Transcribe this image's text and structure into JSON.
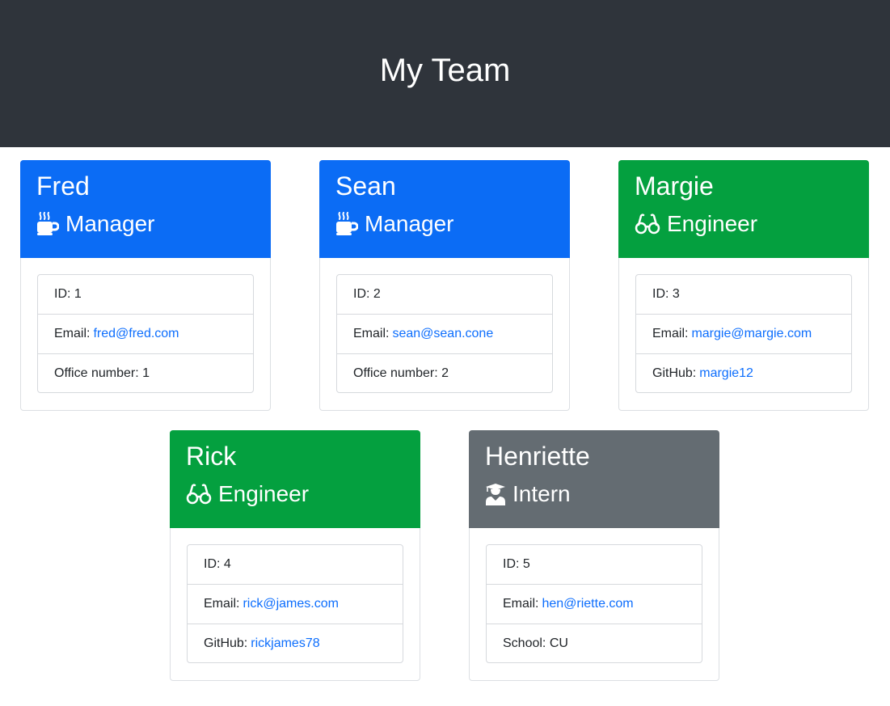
{
  "page_title": "My Team",
  "colors": {
    "header_bg": "#2f343b",
    "manager": "#0b6cf5",
    "engineer": "#04a03f",
    "intern": "#646c72",
    "link": "#0d6efd"
  },
  "cards": [
    {
      "name": "Fred",
      "role": "Manager",
      "icon": "mug-hot-icon",
      "id_text": "ID: 1",
      "email_label": "Email:",
      "email": "fred@fred.com",
      "extra_label": "Office number: 1",
      "extra_link": ""
    },
    {
      "name": "Sean",
      "role": "Manager",
      "icon": "mug-hot-icon",
      "id_text": "ID: 2",
      "email_label": "Email:",
      "email": "sean@sean.cone",
      "extra_label": "Office number: 2",
      "extra_link": ""
    },
    {
      "name": "Margie",
      "role": "Engineer",
      "icon": "glasses-icon",
      "id_text": "ID: 3",
      "email_label": "Email:",
      "email": "margie@margie.com",
      "extra_label": "GitHub:",
      "extra_link": "margie12"
    },
    {
      "name": "Rick",
      "role": "Engineer",
      "icon": "glasses-icon",
      "id_text": "ID: 4",
      "email_label": "Email:",
      "email": "rick@james.com",
      "extra_label": "GitHub:",
      "extra_link": "rickjames78"
    },
    {
      "name": "Henriette",
      "role": "Intern",
      "icon": "user-graduate-icon",
      "id_text": "ID: 5",
      "email_label": "Email:",
      "email": "hen@riette.com",
      "extra_label": "School: CU",
      "extra_link": ""
    }
  ]
}
